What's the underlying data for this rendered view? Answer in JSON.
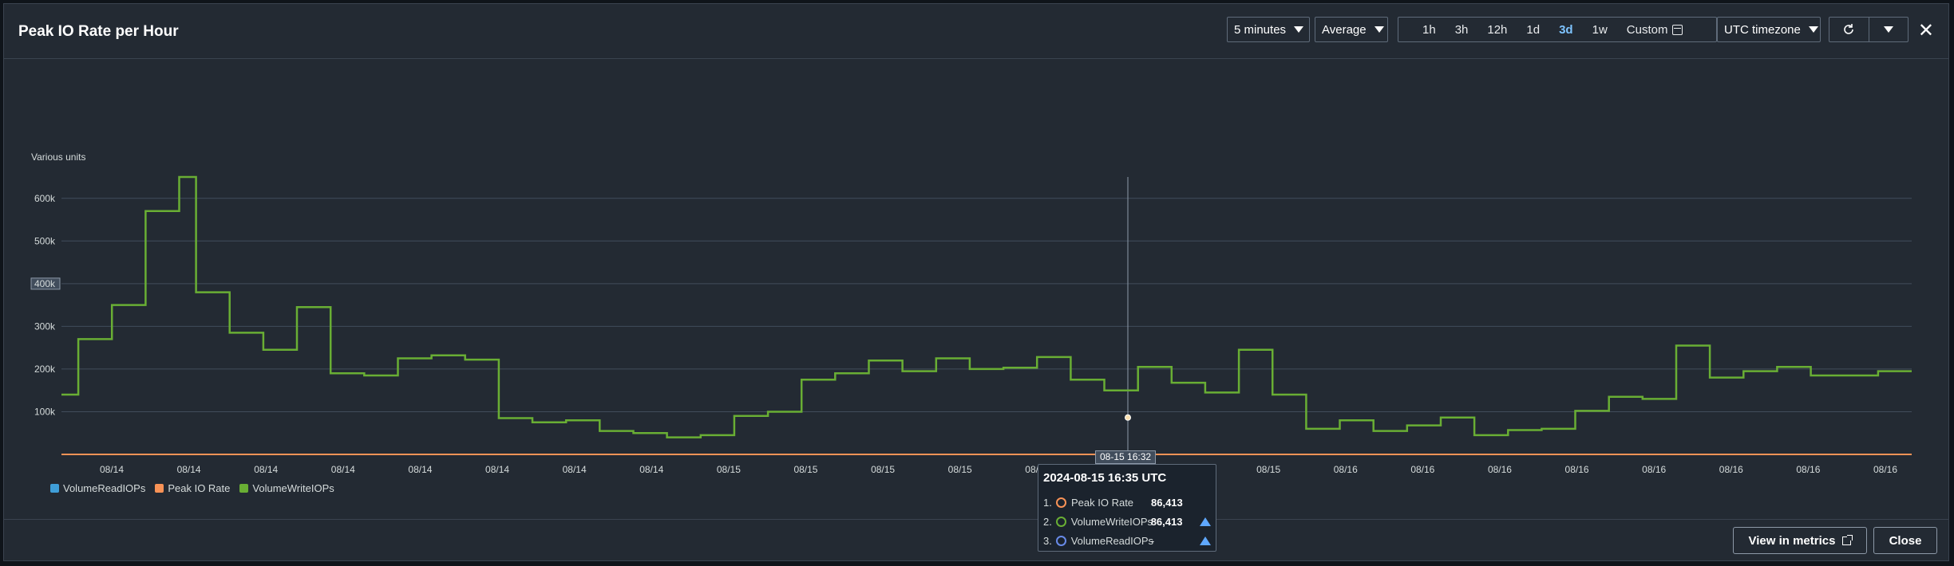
{
  "header": {
    "title": "Peak IO Rate per Hour",
    "period": "5 minutes",
    "stat": "Average",
    "ranges": [
      "1h",
      "3h",
      "12h",
      "1d",
      "3d",
      "1w"
    ],
    "active_range": "3d",
    "custom_label": "Custom",
    "timezone": "UTC timezone"
  },
  "footer": {
    "view_metrics": "View in metrics",
    "close": "Close"
  },
  "tooltip": {
    "title": "2024-08-15 16:35 UTC",
    "crosshair_label": "08-15 16:32",
    "rows": [
      {
        "num": "1.",
        "name": "Peak IO Rate",
        "value": "86,413",
        "color": "#f89256"
      },
      {
        "num": "2.",
        "name": "VolumeWriteIOPs",
        "value": "86,413",
        "color": "#69ae34"
      },
      {
        "num": "3.",
        "name": "VolumeReadIOPs",
        "value": "-",
        "color": "#688ae8"
      }
    ]
  },
  "chart_data": {
    "type": "line",
    "ylabel": "Various units",
    "ylim": [
      0,
      650000
    ],
    "yticks": [
      "100k",
      "200k",
      "300k",
      "400k",
      "500k",
      "600k"
    ],
    "ytick_values": [
      100000,
      200000,
      300000,
      400000,
      500000,
      600000
    ],
    "highlighted_ytick": "400k",
    "xticks": [
      "08/14",
      "08/14",
      "08/14",
      "08/14",
      "08/14",
      "08/14",
      "08/14",
      "08/14",
      "08/15",
      "08/15",
      "08/15",
      "08/15",
      "08/15",
      "08/15",
      "08/15",
      "08/15",
      "08/16",
      "08/16",
      "08/16",
      "08/16",
      "08/16",
      "08/16",
      "08/16",
      "08/16"
    ],
    "grid": true,
    "legend_position": "bottom-left",
    "series": [
      {
        "name": "VolumeReadIOPs",
        "color": "#3f9ed8",
        "values": [
          0,
          0,
          0,
          0,
          0,
          0,
          0,
          0,
          0,
          0,
          0,
          0,
          0,
          0,
          0,
          0,
          0,
          0,
          0,
          0,
          0,
          0,
          0,
          0,
          0,
          0,
          0,
          0,
          0,
          0,
          0,
          0,
          0,
          0,
          0,
          0,
          0,
          0,
          0,
          0,
          0,
          0,
          0,
          0,
          0,
          0,
          0,
          0,
          0,
          0,
          0,
          0,
          0,
          0,
          0,
          0,
          0,
          0,
          0,
          0,
          0,
          0,
          0,
          0,
          0,
          0,
          0,
          0,
          0,
          0,
          0,
          0,
          0,
          0,
          0,
          0,
          0,
          0,
          0,
          0,
          0,
          0,
          0,
          0,
          0,
          0,
          0,
          0,
          0,
          0,
          0,
          0,
          0,
          0,
          0,
          0,
          0,
          0,
          0,
          0,
          0,
          0,
          0,
          0,
          0,
          0
        ]
      },
      {
        "name": "Peak IO Rate",
        "color": "#f89256",
        "values": [
          0,
          0,
          0,
          0,
          0,
          0,
          0,
          0,
          0,
          0,
          0,
          0,
          0,
          0,
          0,
          0,
          0,
          0,
          0,
          0,
          0,
          0,
          0,
          0,
          0,
          0,
          0,
          0,
          0,
          0,
          0,
          0,
          0,
          0,
          0,
          0,
          0,
          0,
          0,
          0,
          0,
          0,
          0,
          0,
          0,
          0,
          0,
          0,
          0,
          0,
          0,
          0,
          0,
          0,
          0,
          0,
          0,
          0,
          0,
          0,
          0,
          0,
          0,
          0,
          0,
          0,
          0,
          0,
          0,
          0,
          0,
          0,
          0,
          0,
          0,
          0,
          0,
          0,
          0,
          0,
          0,
          0,
          0,
          0,
          0,
          0,
          0,
          0,
          0,
          0,
          0,
          0,
          0,
          0,
          0,
          0,
          0,
          0,
          0,
          0,
          0,
          0,
          0,
          0,
          0,
          0
        ]
      },
      {
        "name": "VolumeWriteIOPs",
        "color": "#69ae34",
        "values": [
          140000,
          270000,
          270000,
          350000,
          350000,
          570000,
          570000,
          650000,
          380000,
          380000,
          285000,
          285000,
          245000,
          245000,
          345000,
          345000,
          190000,
          190000,
          185000,
          185000,
          225000,
          225000,
          232000,
          232000,
          222000,
          222000,
          85000,
          85000,
          75000,
          75000,
          80000,
          80000,
          55000,
          55000,
          50000,
          50000,
          40000,
          40000,
          45000,
          45000,
          90000,
          90000,
          100000,
          100000,
          175000,
          175000,
          190000,
          190000,
          220000,
          220000,
          195000,
          195000,
          225000,
          225000,
          200000,
          200000,
          203000,
          203000,
          228000,
          228000,
          175000,
          175000,
          150000,
          150000,
          205000,
          205000,
          168000,
          168000,
          145000,
          145000,
          245000,
          245000,
          140000,
          140000,
          60000,
          60000,
          80000,
          80000,
          55000,
          55000,
          68000,
          68000,
          86413,
          86413,
          45000,
          45000,
          57000,
          57000,
          60000,
          60000,
          102000,
          102000,
          135000,
          135000,
          130000,
          130000,
          255000,
          255000,
          180000,
          180000,
          195000,
          195000,
          205000,
          205000,
          185000,
          185000,
          185000,
          185000,
          195000,
          195000
        ]
      }
    ]
  }
}
